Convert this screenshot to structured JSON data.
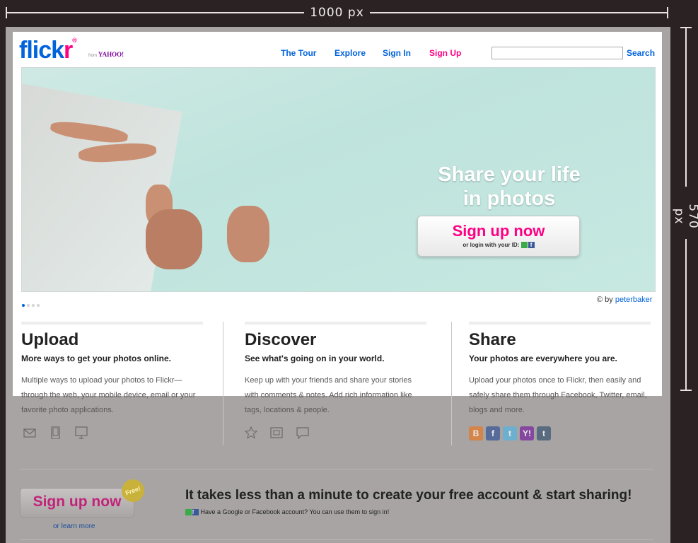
{
  "annotations": {
    "width_label": "1000 px",
    "height_label": "570 px"
  },
  "header": {
    "logo_flick": "flick",
    "logo_r": "r",
    "logo_reg": "®",
    "from_label": "from",
    "yahoo_label": "YAHOO!",
    "nav": {
      "tour": "The Tour",
      "explore": "Explore",
      "signin": "Sign In",
      "signup": "Sign Up"
    },
    "search_value": "",
    "search_button": "Search"
  },
  "hero": {
    "tagline_line1": "Share your life",
    "tagline_line2": "in photos",
    "cta_big": "Sign up now",
    "cta_small": "or login with your ID:",
    "fb_letter": "f"
  },
  "credit": {
    "prefix": "© by",
    "author": "peterbaker"
  },
  "columns": {
    "upload": {
      "title": "Upload",
      "subtitle": "More ways to get your photos online.",
      "body": "Multiple ways to upload your photos to Flickr—through the web, your mobile device, email or your favorite photo applications."
    },
    "discover": {
      "title": "Discover",
      "subtitle": "See what's going on in your world.",
      "body": "Keep up with your friends and share your stories with comments & notes. Add rich information like tags, locations & people."
    },
    "share": {
      "title": "Share",
      "subtitle": "Your photos are everywhere you are.",
      "body": "Upload your photos once to Flickr, then easily and safely share them through Facebook, Twitter, email, blogs and more."
    }
  },
  "footer": {
    "button": "Sign up now",
    "badge": "Free!",
    "learn_more": "or learn more",
    "title": "It takes less than a minute to create your free account & start sharing!",
    "subtitle": "Have a Google or Facebook account? You can use them to sign in!",
    "fb_letter": "f"
  },
  "share_icons": {
    "blogger": "B",
    "facebook": "f",
    "twitter": "t",
    "yahoo": "Y!",
    "tumblr": "t"
  },
  "colors": {
    "blue": "#0063dc",
    "pink": "#ff0084"
  }
}
